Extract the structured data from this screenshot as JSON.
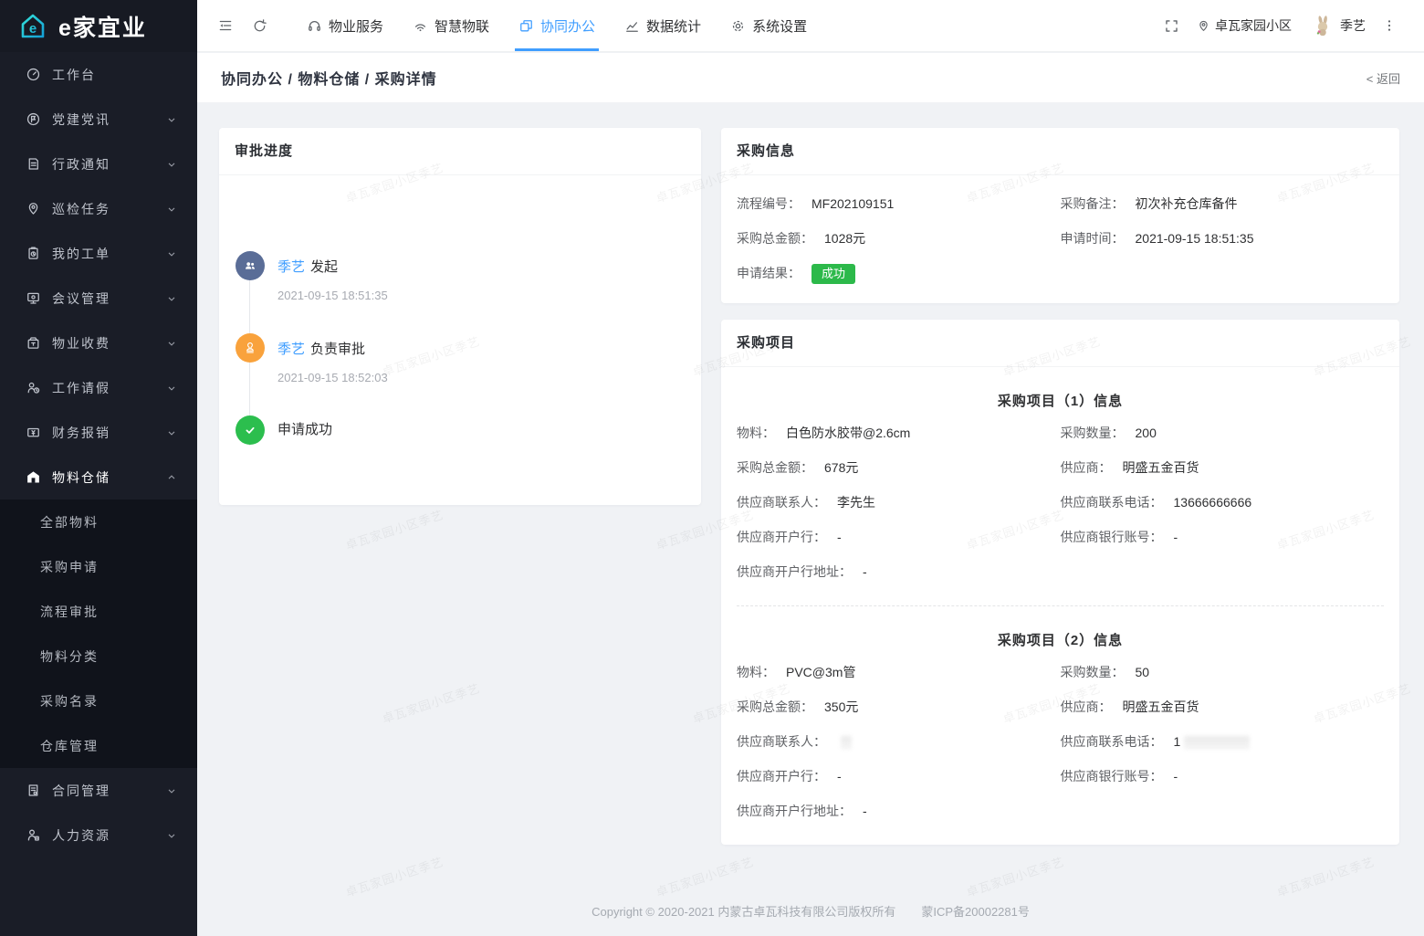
{
  "brand": {
    "name": "e家宜业",
    "logo_letter": "e"
  },
  "sidebar": {
    "items": [
      {
        "label": "工作台"
      },
      {
        "label": "党建党讯"
      },
      {
        "label": "行政通知"
      },
      {
        "label": "巡检任务"
      },
      {
        "label": "我的工单"
      },
      {
        "label": "会议管理"
      },
      {
        "label": "物业收费"
      },
      {
        "label": "工作请假"
      },
      {
        "label": "财务报销"
      },
      {
        "label": "物料仓储"
      },
      {
        "label": "合同管理"
      },
      {
        "label": "人力资源"
      }
    ],
    "submenu": [
      {
        "label": "全部物料"
      },
      {
        "label": "采购申请"
      },
      {
        "label": "流程审批"
      },
      {
        "label": "物料分类"
      },
      {
        "label": "采购名录"
      },
      {
        "label": "仓库管理"
      }
    ]
  },
  "topbar": {
    "tabs": [
      {
        "label": "物业服务"
      },
      {
        "label": "智慧物联"
      },
      {
        "label": "协同办公"
      },
      {
        "label": "数据统计"
      },
      {
        "label": "系统设置"
      }
    ],
    "community": "卓瓦家园小区",
    "user": "季艺"
  },
  "breadcrumb": {
    "path": "协同办公 / 物料仓储 / 采购详情",
    "back": "< 返回"
  },
  "approval": {
    "title": "审批进度",
    "steps": [
      {
        "user": "季艺",
        "action": "发起",
        "time": "2021-09-15 18:51:35"
      },
      {
        "user": "季艺",
        "action": "负责审批",
        "time": "2021-09-15 18:52:03"
      },
      {
        "label": "申请成功"
      }
    ]
  },
  "purchase_info": {
    "title": "采购信息",
    "fields": [
      {
        "label": "流程编号：",
        "value": "MF202109151"
      },
      {
        "label": "采购备注：",
        "value": "初次补充仓库备件"
      },
      {
        "label": "采购总金额：",
        "value": "1028元"
      },
      {
        "label": "申请时间：",
        "value": "2021-09-15 18:51:35"
      },
      {
        "label": "申请结果：",
        "value": "成功"
      }
    ]
  },
  "purchase_items": {
    "title": "采购项目",
    "sections": [
      {
        "heading": "采购项目（1）信息",
        "fields": [
          {
            "label": "物料：",
            "value": "白色防水胶带@2.6cm"
          },
          {
            "label": "采购数量：",
            "value": "200"
          },
          {
            "label": "采购总金额：",
            "value": "678元"
          },
          {
            "label": "供应商：",
            "value": "明盛五金百货"
          },
          {
            "label": "供应商联系人：",
            "value": "李先生"
          },
          {
            "label": "供应商联系电话：",
            "value": "13666666666"
          },
          {
            "label": "供应商开户行：",
            "value": "-"
          },
          {
            "label": "供应商银行账号：",
            "value": "-"
          },
          {
            "label": "供应商开户行地址：",
            "value": "-"
          }
        ]
      },
      {
        "heading": "采购项目（2）信息",
        "fields": [
          {
            "label": "物料：",
            "value": "PVC@3m管"
          },
          {
            "label": "采购数量：",
            "value": "50"
          },
          {
            "label": "采购总金额：",
            "value": "350元"
          },
          {
            "label": "供应商：",
            "value": "明盛五金百货"
          },
          {
            "label": "供应商联系人：",
            "value": "",
            "masked": true
          },
          {
            "label": "供应商联系电话：",
            "value": "1",
            "masked": true
          },
          {
            "label": "供应商开户行：",
            "value": "-"
          },
          {
            "label": "供应商银行账号：",
            "value": "-"
          },
          {
            "label": "供应商开户行地址：",
            "value": "-"
          }
        ]
      }
    ]
  },
  "footer": {
    "copyright": "Copyright © 2020-2021 内蒙古卓瓦科技有限公司版权所有",
    "icp": "蒙ICP备20002281号"
  },
  "watermark": {
    "text": "卓瓦家园小区季艺"
  },
  "colors": {
    "accent": "#409eff",
    "success": "#2cb94a",
    "warning": "#f9a23c",
    "slate": "#5a6d97",
    "sidebar_bg": "#1a1d27",
    "submenu_bg": "#10131b",
    "content_bg": "#f0f2f5"
  }
}
